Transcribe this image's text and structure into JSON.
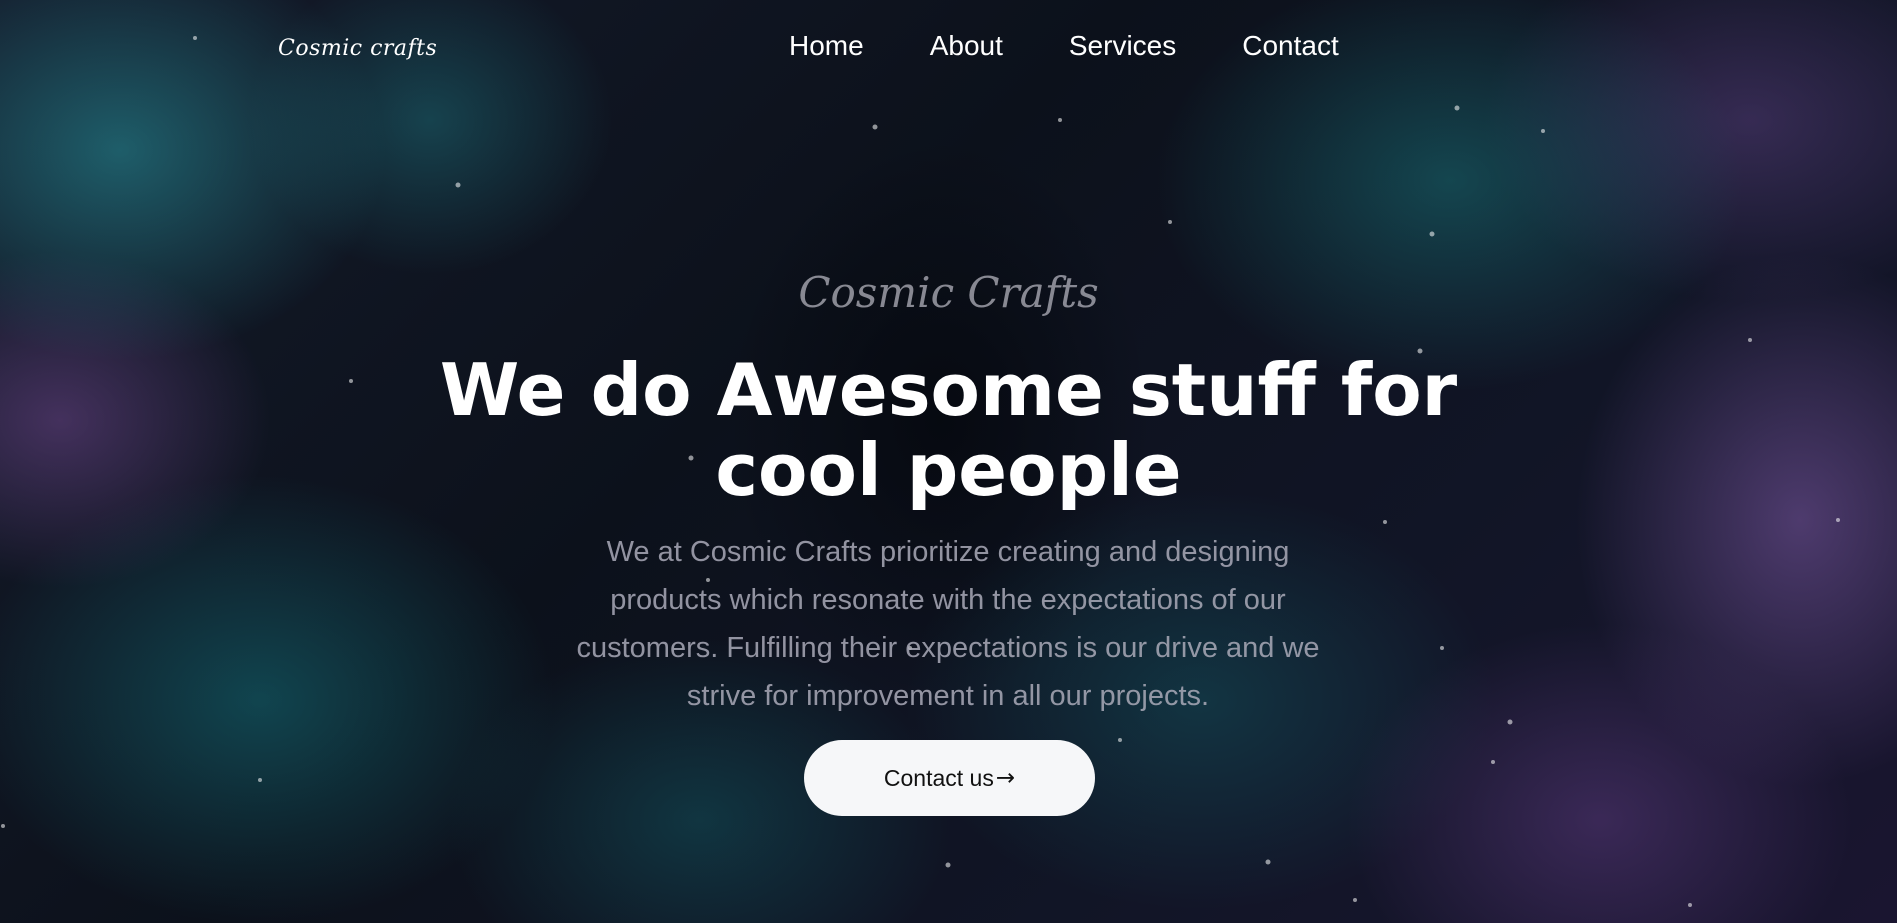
{
  "brand": {
    "logo_text": "Cosmic crafts"
  },
  "nav": {
    "items": [
      {
        "label": "Home"
      },
      {
        "label": "About"
      },
      {
        "label": "Services"
      },
      {
        "label": "Contact"
      }
    ]
  },
  "hero": {
    "script_title": "Cosmic Crafts",
    "headline_line1": "We do Awesome stuff for",
    "headline_line2": "cool people",
    "description": "We at Cosmic Crafts prioritize creating and designing products which resonate with the expectations of our customers. Fulfilling their expectations is our drive and we strive for improvement in all our projects.",
    "cta_label": "Contact us",
    "cta_icon": "arrow-right-icon"
  },
  "colors": {
    "background": "#0b0e17",
    "accent_teal": "#1e7a82",
    "accent_purple": "#6b4a8c",
    "cta_background": "#f6f7f9",
    "text_primary": "#ffffff"
  }
}
